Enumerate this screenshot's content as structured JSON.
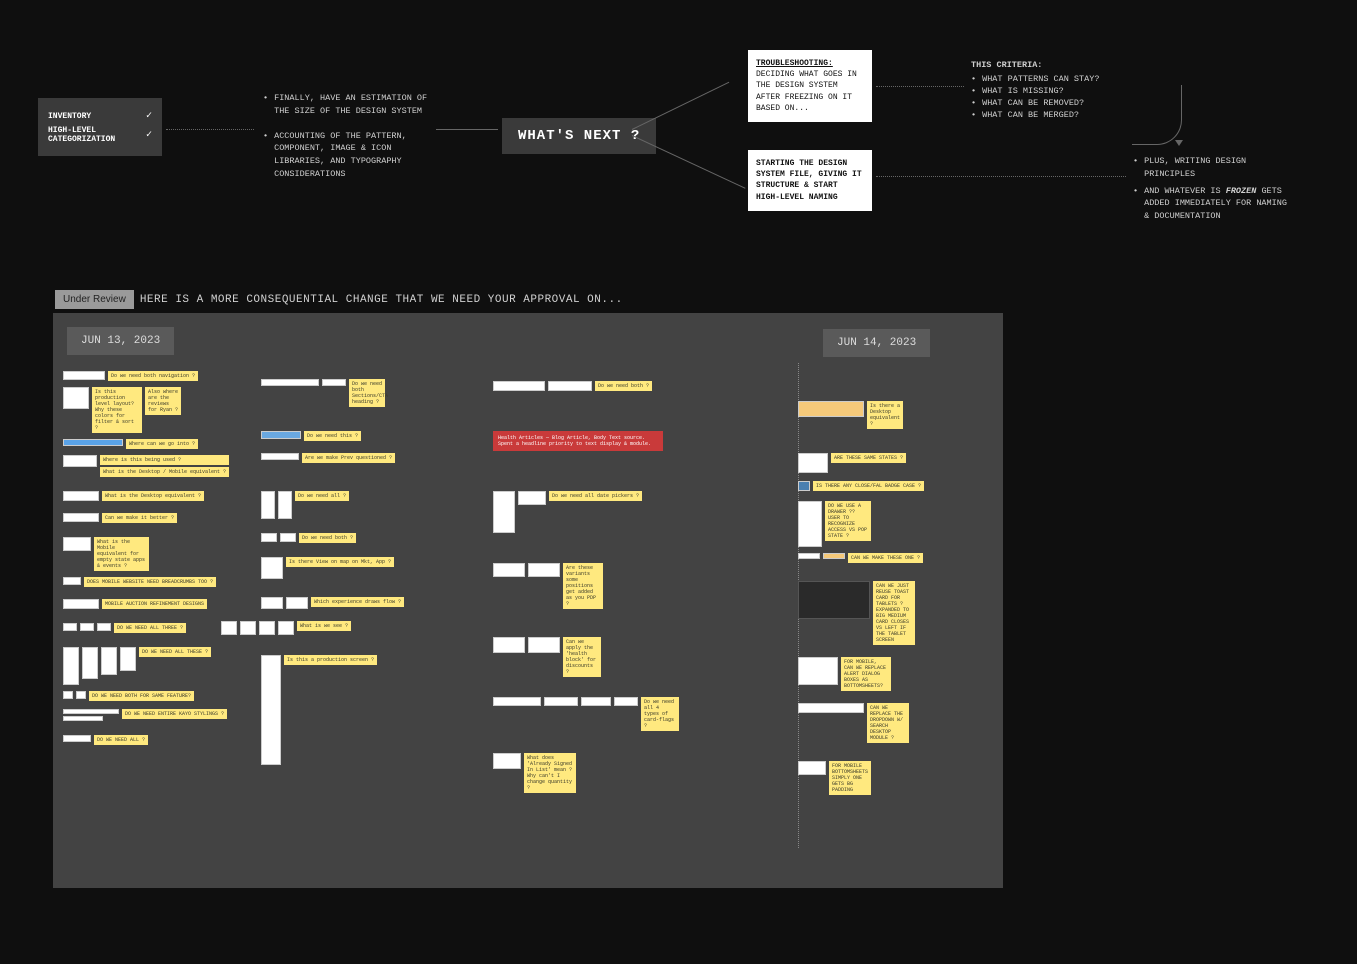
{
  "diagram": {
    "checklist": {
      "item1": "INVENTORY",
      "item2": "HIGH-LEVEL CATEGORIZATION"
    },
    "bullets1": {
      "a": "FINALLY, HAVE AN ESTIMATION OF THE SIZE OF THE DESIGN SYSTEM",
      "b": "ACCOUNTING OF THE PATTERN, COMPONENT, IMAGE & ICON LIBRARIES, AND TYPOGRAPHY CONSIDERATIONS"
    },
    "whatsnext": "WHAT'S NEXT ?",
    "trouble": {
      "title": "TROUBLESHOOTING:",
      "body": "DECIDING WHAT GOES IN THE DESIGN SYSTEM AFTER FREEZING ON IT BASED ON..."
    },
    "start": "STARTING THE DESIGN SYSTEM FILE, GIVING IT STRUCTURE & START HIGH-LEVEL NAMING",
    "criteria": {
      "title": "THIS CRITERIA:",
      "c1": "WHAT PATTERNS CAN STAY?",
      "c2": "WHAT IS MISSING?",
      "c3": "WHAT CAN BE REMOVED?",
      "c4": "WHAT CAN BE MERGED?"
    },
    "bullets2": {
      "a": "PLUS, WRITING DESIGN PRINCIPLES",
      "b_pre": "AND WHATEVER IS ",
      "b_frozen": "FROZEN",
      "b_post": " GETS ADDED IMMEDIATELY FOR NAMING & DOCUMENTATION"
    }
  },
  "review": {
    "badge": "Under Review",
    "text": "HERE IS A MORE CONSEQUENTIAL CHANGE THAT WE NEED YOUR APPROVAL ON..."
  },
  "board": {
    "date1": "JUN 13, 2023",
    "date2": "JUN 14, 2023",
    "col1": {
      "n1": "Do we need both navigation ?",
      "n2": "Is this production level layout? Why these colors for filter & sort ?",
      "n2b": "Also where are the reviews for Ryan ?",
      "n3": "Where can we go into ?",
      "n4a": "Where is this being used ?",
      "n4b": "What is the Desktop / Mobile equivalent ?",
      "n5": "What is the Desktop equivalent ?",
      "n6": "Can we make it better ?",
      "n7": "What is the Mobile equivalent for empty state apps & events ?",
      "n8": "DOES MOBILE WEBSITE NEED BREADCRUMBS TOO ?",
      "n9": "MOBILE AUCTION REFINEMENT DESIGNS",
      "n10": "DO WE NEED ALL THREE ?",
      "n11": "DO WE NEED ALL THESE ?",
      "n12": "DO WE NEED BOTH FOR SAME FEATURE?",
      "n13": "DO WE NEED ENTIRE KAYO STYLINGS ?",
      "n14": "DO WE NEED ALL ?"
    },
    "col2": {
      "n1": "Do we need both Sections/CTA heading ?",
      "n2": "Do we need this ?",
      "n3": "Are we make Prev questioned ?",
      "n4": "Do we need all ?",
      "n5": "Do we need both ?",
      "n6": "Is there View on map on Mkt, App ?",
      "n7": "Which experience draws flow ?",
      "n8": "What is we see ?",
      "n9": "Is this a production screen ?"
    },
    "col3": {
      "n1": "Do we need both ?",
      "nred": "Health Articles — Blog Article, Body Text source. Spent a headline priority to text display & module.",
      "n2": "Do we need all date pickers ?",
      "n3": "Are these variants some positions get added as you PDP ?",
      "n4": "Can we apply the 'health block' for discounts ?",
      "n5": "Do we need all 4 types of card-flags ?",
      "n6": "What does 'Already Signed In List' mean ? Why can't I change quantity ?"
    },
    "col4": {
      "n1": "Is there a Desktop equivalent ?",
      "n2": "ARE THESE SAME STATES ?",
      "n3": "IS THERE ANY CLOSE/FAL BADGE CASE ?",
      "n4": "DO WE USE A DRAWER ?? USER TO RECOGNIZE ACCESS VS POP STATE ?",
      "n5": "CAN WE MAKE THESE ONE ?",
      "n6": "CAN WE JUST REUSE TOAST CARD FOR TABLETS ?   EXPANDED TO BIG   MEDIUM CARD CLOSES VS LEFT IF THE TABLET SCREEN",
      "n7": "FOR MOBILE, CAN WE REPLACE ALERT DIALOG BOXES AS BOTTOMSHEETS?",
      "n8": "CAN WE REPLACE THE DROPDOWN W/ SEARCH DESKTOP MODULE ?",
      "n9": "FOR MOBILE BOTTOMSHEETS SIMPLY ONE GETS BG PADDING"
    }
  }
}
